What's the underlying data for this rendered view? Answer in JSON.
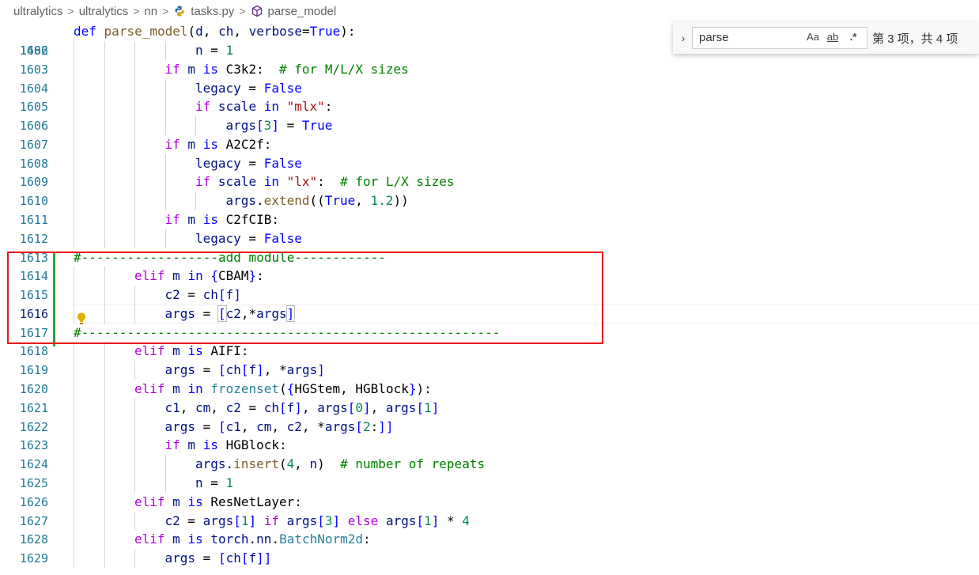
{
  "breadcrumb": {
    "items": [
      "ultralytics",
      "ultralytics",
      "nn",
      "tasks.py",
      "parse_model"
    ],
    "separator": ">",
    "icons": [
      "python-file-icon",
      "cube-symbol-icon"
    ]
  },
  "sticky": {
    "line": "1486",
    "parts": [
      "def",
      " ",
      "parse_model",
      "(",
      "d",
      ", ",
      "ch",
      ", ",
      "verbose",
      "=",
      "True",
      "):"
    ]
  },
  "lines": [
    {
      "n": "1602",
      "indent": 4,
      "parts": [
        [
          "v",
          "n"
        ],
        [
          "p",
          " = "
        ],
        [
          "n",
          "1"
        ]
      ]
    },
    {
      "n": "1603",
      "indent": 3,
      "parts": [
        [
          "c",
          "if"
        ],
        [
          "p",
          " "
        ],
        [
          "v",
          "m"
        ],
        [
          "p",
          " "
        ],
        [
          "k",
          "is"
        ],
        [
          "p",
          " C3k2:  "
        ],
        [
          "cm",
          "# for M/L/X sizes"
        ]
      ]
    },
    {
      "n": "1604",
      "indent": 4,
      "parts": [
        [
          "v",
          "legacy"
        ],
        [
          "p",
          " = "
        ],
        [
          "k",
          "False"
        ]
      ]
    },
    {
      "n": "1605",
      "indent": 4,
      "parts": [
        [
          "c",
          "if"
        ],
        [
          "p",
          " "
        ],
        [
          "v",
          "scale"
        ],
        [
          "p",
          " "
        ],
        [
          "k",
          "in"
        ],
        [
          "p",
          " "
        ],
        [
          "s",
          "\"mlx\""
        ],
        [
          "p",
          ":"
        ]
      ]
    },
    {
      "n": "1606",
      "indent": 5,
      "parts": [
        [
          "v",
          "args"
        ],
        [
          "k",
          "["
        ],
        [
          "n",
          "3"
        ],
        [
          "k",
          "]"
        ],
        [
          "p",
          " = "
        ],
        [
          "k",
          "True"
        ]
      ]
    },
    {
      "n": "1607",
      "indent": 3,
      "parts": [
        [
          "c",
          "if"
        ],
        [
          "p",
          " "
        ],
        [
          "v",
          "m"
        ],
        [
          "p",
          " "
        ],
        [
          "k",
          "is"
        ],
        [
          "p",
          " A2C2f:"
        ]
      ]
    },
    {
      "n": "1608",
      "indent": 4,
      "parts": [
        [
          "v",
          "legacy"
        ],
        [
          "p",
          " = "
        ],
        [
          "k",
          "False"
        ]
      ]
    },
    {
      "n": "1609",
      "indent": 4,
      "parts": [
        [
          "c",
          "if"
        ],
        [
          "p",
          " "
        ],
        [
          "v",
          "scale"
        ],
        [
          "p",
          " "
        ],
        [
          "k",
          "in"
        ],
        [
          "p",
          " "
        ],
        [
          "s",
          "\"lx\""
        ],
        [
          "p",
          ":  "
        ],
        [
          "cm",
          "# for L/X sizes"
        ]
      ]
    },
    {
      "n": "1610",
      "indent": 5,
      "parts": [
        [
          "v",
          "args"
        ],
        [
          "p",
          "."
        ],
        [
          "fn",
          "extend"
        ],
        [
          "p",
          "(("
        ],
        [
          "k",
          "True"
        ],
        [
          "p",
          ", "
        ],
        [
          "n",
          "1.2"
        ],
        [
          "p",
          "))"
        ]
      ]
    },
    {
      "n": "1611",
      "indent": 3,
      "parts": [
        [
          "c",
          "if"
        ],
        [
          "p",
          " "
        ],
        [
          "v",
          "m"
        ],
        [
          "p",
          " "
        ],
        [
          "k",
          "is"
        ],
        [
          "p",
          " C2fCIB:"
        ]
      ]
    },
    {
      "n": "1612",
      "indent": 4,
      "parts": [
        [
          "v",
          "legacy"
        ],
        [
          "p",
          " = "
        ],
        [
          "k",
          "False"
        ]
      ]
    },
    {
      "n": "1613",
      "indent": 0,
      "parts": [
        [
          "cm",
          "#------------------add module------------"
        ]
      ]
    },
    {
      "n": "1614",
      "indent": 2,
      "parts": [
        [
          "c",
          "elif"
        ],
        [
          "p",
          " "
        ],
        [
          "v",
          "m"
        ],
        [
          "p",
          " "
        ],
        [
          "k",
          "in"
        ],
        [
          "p",
          " "
        ],
        [
          "k",
          "{"
        ],
        [
          "p",
          "CBAM"
        ],
        [
          "k",
          "}"
        ],
        [
          "p",
          ":"
        ]
      ]
    },
    {
      "n": "1615",
      "indent": 3,
      "parts": [
        [
          "v",
          "c2"
        ],
        [
          "p",
          " = "
        ],
        [
          "v",
          "ch"
        ],
        [
          "k",
          "["
        ],
        [
          "v",
          "f"
        ],
        [
          "k",
          "]"
        ]
      ]
    },
    {
      "n": "1616",
      "indent": 3,
      "current": true,
      "parts": [
        [
          "v",
          "args"
        ],
        [
          "p",
          " = "
        ],
        [
          "b",
          "["
        ],
        [
          "v",
          "c2"
        ],
        [
          "p",
          ",*"
        ],
        [
          "v",
          "args"
        ],
        [
          "b",
          "]"
        ]
      ]
    },
    {
      "n": "1617",
      "indent": 0,
      "parts": [
        [
          "cm",
          "#-------------------------------------------------------"
        ]
      ]
    },
    {
      "n": "1618",
      "indent": 2,
      "parts": [
        [
          "c",
          "elif"
        ],
        [
          "p",
          " "
        ],
        [
          "v",
          "m"
        ],
        [
          "p",
          " "
        ],
        [
          "k",
          "is"
        ],
        [
          "p",
          " AIFI:"
        ]
      ]
    },
    {
      "n": "1619",
      "indent": 3,
      "parts": [
        [
          "v",
          "args"
        ],
        [
          "p",
          " = "
        ],
        [
          "k",
          "["
        ],
        [
          "v",
          "ch"
        ],
        [
          "k",
          "["
        ],
        [
          "v",
          "f"
        ],
        [
          "k",
          "]"
        ],
        [
          "p",
          ", *"
        ],
        [
          "v",
          "args"
        ],
        [
          "k",
          "]"
        ]
      ]
    },
    {
      "n": "1620",
      "indent": 2,
      "parts": [
        [
          "c",
          "elif"
        ],
        [
          "p",
          " "
        ],
        [
          "v",
          "m"
        ],
        [
          "p",
          " "
        ],
        [
          "k",
          "in"
        ],
        [
          "p",
          " "
        ],
        [
          "t",
          "frozenset"
        ],
        [
          "p",
          "("
        ],
        [
          "k",
          "{"
        ],
        [
          "p",
          "HGStem, HGBlock"
        ],
        [
          "k",
          "}"
        ],
        [
          "p",
          "):"
        ]
      ]
    },
    {
      "n": "1621",
      "indent": 3,
      "parts": [
        [
          "v",
          "c1"
        ],
        [
          "p",
          ", "
        ],
        [
          "v",
          "cm"
        ],
        [
          "p",
          ", "
        ],
        [
          "v",
          "c2"
        ],
        [
          "p",
          " = "
        ],
        [
          "v",
          "ch"
        ],
        [
          "k",
          "["
        ],
        [
          "v",
          "f"
        ],
        [
          "k",
          "]"
        ],
        [
          "p",
          ", "
        ],
        [
          "v",
          "args"
        ],
        [
          "k",
          "["
        ],
        [
          "n",
          "0"
        ],
        [
          "k",
          "]"
        ],
        [
          "p",
          ", "
        ],
        [
          "v",
          "args"
        ],
        [
          "k",
          "["
        ],
        [
          "n",
          "1"
        ],
        [
          "k",
          "]"
        ]
      ]
    },
    {
      "n": "1622",
      "indent": 3,
      "parts": [
        [
          "v",
          "args"
        ],
        [
          "p",
          " = "
        ],
        [
          "k",
          "["
        ],
        [
          "v",
          "c1"
        ],
        [
          "p",
          ", "
        ],
        [
          "v",
          "cm"
        ],
        [
          "p",
          ", "
        ],
        [
          "v",
          "c2"
        ],
        [
          "p",
          ", *"
        ],
        [
          "v",
          "args"
        ],
        [
          "k",
          "["
        ],
        [
          "n",
          "2"
        ],
        [
          "p",
          ":"
        ],
        [
          "k",
          "]]"
        ]
      ]
    },
    {
      "n": "1623",
      "indent": 3,
      "parts": [
        [
          "c",
          "if"
        ],
        [
          "p",
          " "
        ],
        [
          "v",
          "m"
        ],
        [
          "p",
          " "
        ],
        [
          "k",
          "is"
        ],
        [
          "p",
          " HGBlock:"
        ]
      ]
    },
    {
      "n": "1624",
      "indent": 4,
      "parts": [
        [
          "v",
          "args"
        ],
        [
          "p",
          "."
        ],
        [
          "fn",
          "insert"
        ],
        [
          "p",
          "("
        ],
        [
          "n",
          "4"
        ],
        [
          "p",
          ", "
        ],
        [
          "v",
          "n"
        ],
        [
          "p",
          ")  "
        ],
        [
          "cm",
          "# number of repeats"
        ]
      ]
    },
    {
      "n": "1625",
      "indent": 4,
      "parts": [
        [
          "v",
          "n"
        ],
        [
          "p",
          " = "
        ],
        [
          "n",
          "1"
        ]
      ]
    },
    {
      "n": "1626",
      "indent": 2,
      "parts": [
        [
          "c",
          "elif"
        ],
        [
          "p",
          " "
        ],
        [
          "v",
          "m"
        ],
        [
          "p",
          " "
        ],
        [
          "k",
          "is"
        ],
        [
          "p",
          " ResNetLayer:"
        ]
      ]
    },
    {
      "n": "1627",
      "indent": 3,
      "parts": [
        [
          "v",
          "c2"
        ],
        [
          "p",
          " = "
        ],
        [
          "v",
          "args"
        ],
        [
          "k",
          "["
        ],
        [
          "n",
          "1"
        ],
        [
          "k",
          "]"
        ],
        [
          "p",
          " "
        ],
        [
          "c",
          "if"
        ],
        [
          "p",
          " "
        ],
        [
          "v",
          "args"
        ],
        [
          "k",
          "["
        ],
        [
          "n",
          "3"
        ],
        [
          "k",
          "]"
        ],
        [
          "p",
          " "
        ],
        [
          "c",
          "else"
        ],
        [
          "p",
          " "
        ],
        [
          "v",
          "args"
        ],
        [
          "k",
          "["
        ],
        [
          "n",
          "1"
        ],
        [
          "k",
          "]"
        ],
        [
          "p",
          " * "
        ],
        [
          "n",
          "4"
        ]
      ]
    },
    {
      "n": "1628",
      "indent": 2,
      "parts": [
        [
          "c",
          "elif"
        ],
        [
          "p",
          " "
        ],
        [
          "v",
          "m"
        ],
        [
          "p",
          " "
        ],
        [
          "k",
          "is"
        ],
        [
          "p",
          " "
        ],
        [
          "v",
          "torch"
        ],
        [
          "p",
          "."
        ],
        [
          "v",
          "nn"
        ],
        [
          "p",
          "."
        ],
        [
          "t",
          "BatchNorm2d"
        ],
        [
          "p",
          ":"
        ]
      ]
    },
    {
      "n": "1629",
      "indent": 3,
      "parts": [
        [
          "v",
          "args"
        ],
        [
          "p",
          " = "
        ],
        [
          "k",
          "["
        ],
        [
          "v",
          "ch"
        ],
        [
          "k",
          "["
        ],
        [
          "v",
          "f"
        ],
        [
          "k",
          "]]"
        ]
      ]
    }
  ],
  "find": {
    "query": "parse",
    "opt_case": "Aa",
    "opt_word": "ab",
    "opt_regex": ".*",
    "result": "第 3 项，共 4 项"
  },
  "colors": {
    "keyword": "#0000ff",
    "control": "#af00db",
    "function": "#795e26",
    "variable": "#001080",
    "number": "#098658",
    "string": "#a31515",
    "comment": "#008000",
    "highlight_box": "#e8191b"
  }
}
